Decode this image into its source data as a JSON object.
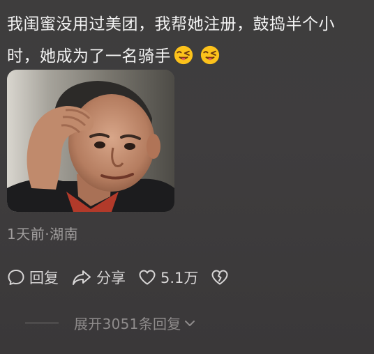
{
  "comment": {
    "text": "我闺蜜没用过美团，我帮她注册，鼓捣半个小时，她成为了一名骑手",
    "emojis": [
      "wink-tongue-emoji",
      "wink-tongue-emoji"
    ]
  },
  "meta": {
    "info": "1天前·湖南"
  },
  "actions": {
    "reply_label": "回复",
    "share_label": "分享",
    "like_count": "5.1万"
  },
  "replies": {
    "expand_label": "展开3051条回复"
  },
  "colors": {
    "background": "#3e3d3d",
    "text": "#f3f3f3",
    "secondary": "#a09d9d"
  }
}
